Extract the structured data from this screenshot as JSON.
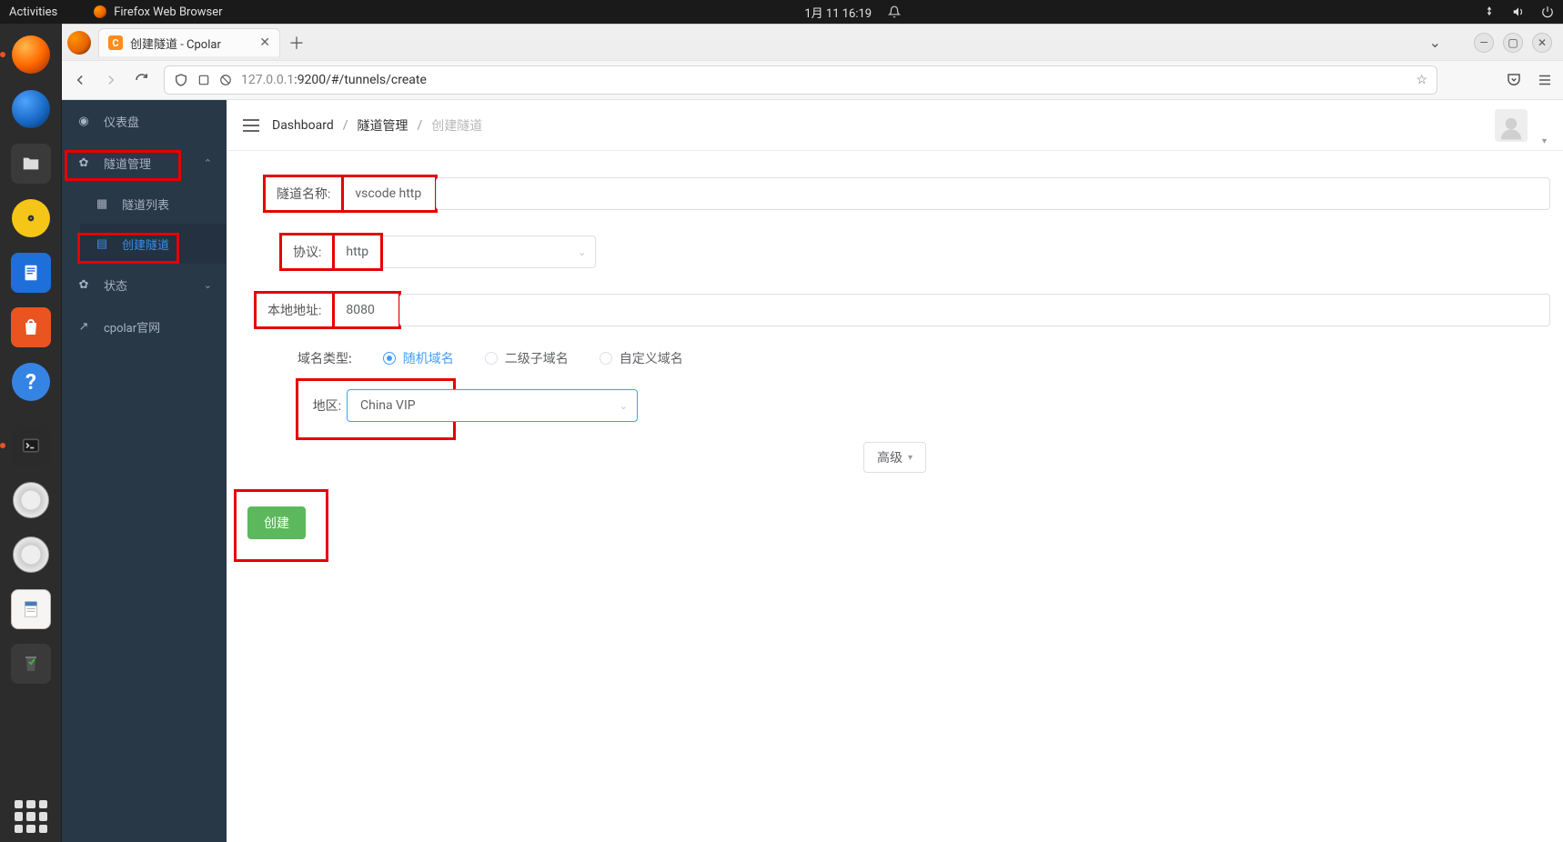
{
  "gnome": {
    "activities": "Activities",
    "app_label": "Firefox Web Browser",
    "datetime": "1月 11  16:19"
  },
  "browser": {
    "tab_title": "创建隧道 - Cpolar",
    "url_host_muted": "127.0.0.1",
    "url_rest": ":9200/#/tunnels/create"
  },
  "sidebar": {
    "dashboard": "仪表盘",
    "tunnel_manage": "隧道管理",
    "tunnel_list": "隧道列表",
    "tunnel_create": "创建隧道",
    "status": "状态",
    "cpolar_site": "cpolar官网"
  },
  "breadcrumb": {
    "dash": "Dashboard",
    "sep": "/",
    "manage": "隧道管理",
    "current": "创建隧道"
  },
  "form": {
    "name_label": "隧道名称:",
    "name_value": "vscode http",
    "proto_label": "协议:",
    "proto_value": "http",
    "local_label": "本地地址:",
    "local_value": "8080",
    "domain_type_label": "域名类型:",
    "domain_opt_random": "随机域名",
    "domain_opt_sub": "二级子域名",
    "domain_opt_custom": "自定义域名",
    "region_label": "地区:",
    "region_value": "China VIP",
    "advanced": "高级",
    "create": "创建"
  }
}
